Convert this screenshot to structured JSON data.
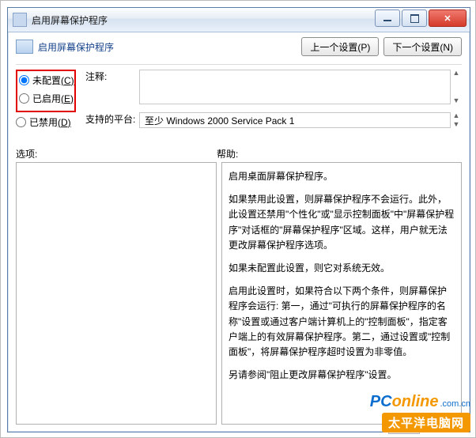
{
  "window": {
    "title": "启用屏幕保护程序",
    "header_title": "启用屏幕保护程序",
    "prev_btn": "上一个设置(P)",
    "next_btn": "下一个设置(N)"
  },
  "radios": {
    "not_configured": "未配置",
    "not_configured_key": "(C)",
    "enabled": "已启用",
    "enabled_key": "(E)",
    "disabled": "已禁用",
    "disabled_key": "(D)"
  },
  "labels": {
    "comment": "注释:",
    "platform": "支持的平台:",
    "options": "选项:",
    "help": "帮助:"
  },
  "fields": {
    "comment_value": "",
    "platform_value": "至少 Windows 2000 Service Pack 1"
  },
  "help": {
    "p1": "启用桌面屏幕保护程序。",
    "p2": "如果禁用此设置，则屏幕保护程序不会运行。此外，此设置还禁用\"个性化\"或\"显示控制面板\"中\"屏幕保护程序\"对话框的\"屏幕保护程序\"区域。这样，用户就无法更改屏幕保护程序选项。",
    "p3": "如果未配置此设置，则它对系统无效。",
    "p4": "启用此设置时，如果符合以下两个条件，则屏幕保护程序会运行: 第一，通过\"可执行的屏幕保护程序的名称\"设置或通过客户端计算机上的\"控制面板\"，指定客户端上的有效屏幕保护程序。第二，通过设置或\"控制面板\"，将屏幕保护程序超时设置为非零值。",
    "p5": "另请参阅\"阻止更改屏幕保护程序\"设置。"
  },
  "watermark": {
    "brand_a": "PC",
    "brand_b": "online",
    "brand_suffix": ".com.cn",
    "sub": "太平洋电脑网"
  }
}
